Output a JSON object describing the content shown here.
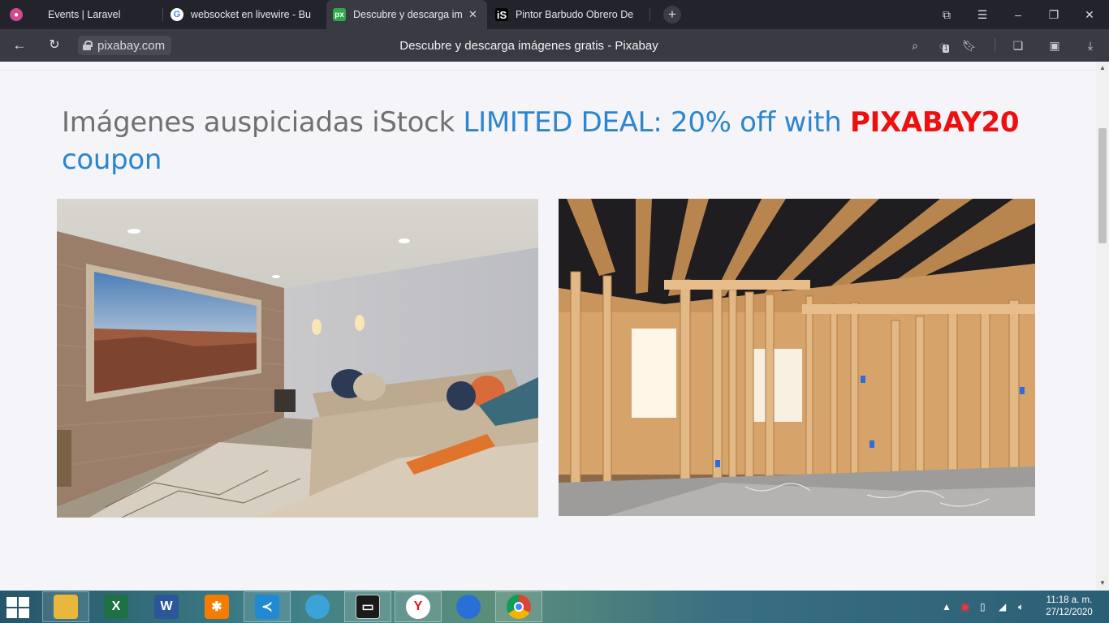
{
  "browser": {
    "tabs": [
      {
        "title": "Events | Laravel",
        "favicon": "laravel-icon",
        "color": "#d04a8c"
      },
      {
        "title": "websocket en livewire - Bu",
        "favicon": "google-icon",
        "color": "#ffffff"
      },
      {
        "title": "Descubre y descarga im",
        "favicon": "pixabay-icon",
        "color": "#2eaa4a",
        "active": true
      },
      {
        "title": "Pintor Barbudo Obrero De",
        "favicon": "istock-icon",
        "color": "#000000"
      }
    ],
    "favicon_text": {
      "pixabay": "px",
      "istock": "iS"
    },
    "url": "pixabay.com",
    "page_title": "Descubre y descarga imágenes gratis - Pixabay",
    "reader_badge": "1"
  },
  "page": {
    "heading_prefix": "Imágenes auspiciadas iStock",
    "heading_deal": "LIMITED DEAL: 20% off with",
    "heading_code": "PIXABAY20",
    "heading_suffix": "coupon",
    "images": [
      {
        "subject": "home theater living room"
      },
      {
        "subject": "house framing under construction"
      }
    ]
  },
  "taskbar": {
    "apps": [
      "file-explorer",
      "excel",
      "word",
      "xampp",
      "vscode",
      "elephant-app",
      "terminal",
      "yandex-browser",
      "firefox-developer",
      "chrome"
    ],
    "clock_time": "11:18 a. m.",
    "clock_date": "27/12/2020"
  },
  "colors": {
    "deal": "#2b85cf",
    "code": "#ee0f0f",
    "heading": "#707070",
    "tabbar": "#23232b",
    "addrbar": "#3a3a43"
  }
}
